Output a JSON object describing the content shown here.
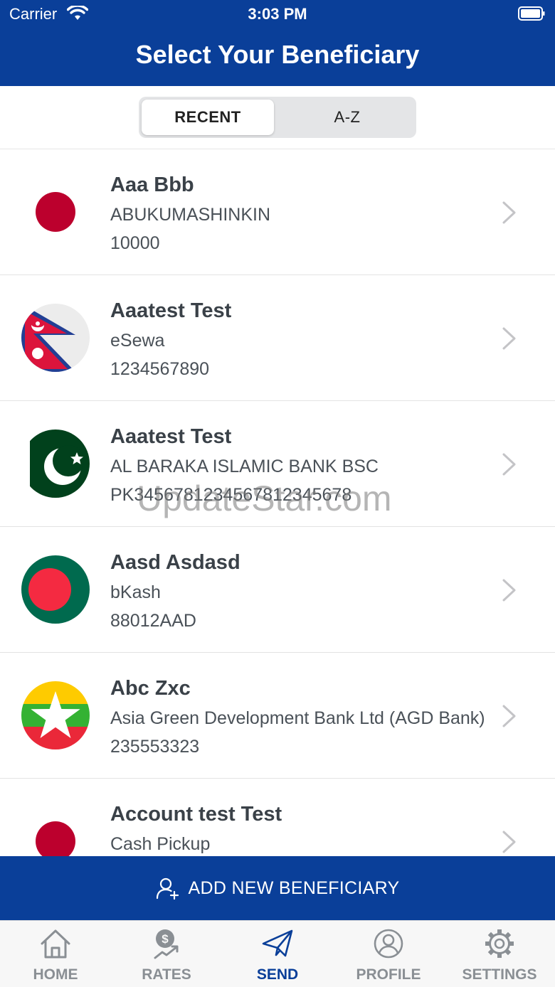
{
  "status_bar": {
    "carrier": "Carrier",
    "time": "3:03 PM"
  },
  "header": {
    "title": "Select Your Beneficiary"
  },
  "segment": {
    "recent": "RECENT",
    "az": "A-Z"
  },
  "beneficiaries": [
    {
      "name": "Aaa Bbb",
      "bank": "ABUKUMASHINKIN",
      "account": "10000",
      "flag": "japan-flag-icon"
    },
    {
      "name": "Aaatest Test",
      "bank": "eSewa",
      "account": "1234567890",
      "flag": "nepal-flag-icon"
    },
    {
      "name": "Aaatest Test",
      "bank": "AL BARAKA ISLAMIC BANK BSC",
      "account": "PK3456781234567812345678",
      "flag": "pakistan-flag-icon"
    },
    {
      "name": "Aasd Asdasd",
      "bank": "bKash",
      "account": "88012AAD",
      "flag": "bangladesh-flag-icon"
    },
    {
      "name": "Abc Zxc",
      "bank": "Asia Green Development Bank Ltd (AGD Bank)",
      "account": "235553323",
      "flag": "myanmar-flag-icon"
    },
    {
      "name": "Account test Test",
      "bank": "Cash Pickup",
      "account": "",
      "flag": "japan-flag-icon"
    }
  ],
  "watermark": "UpdateStar.com",
  "add_button": {
    "label": "ADD NEW BENEFICIARY"
  },
  "tabs": [
    {
      "label": "HOME",
      "icon": "home-icon"
    },
    {
      "label": "RATES",
      "icon": "rates-icon"
    },
    {
      "label": "SEND",
      "icon": "send-icon",
      "active": true
    },
    {
      "label": "PROFILE",
      "icon": "profile-icon"
    },
    {
      "label": "SETTINGS",
      "icon": "settings-icon"
    }
  ],
  "colors": {
    "primary": "#0a3f99",
    "tab_inactive": "#8a8f94",
    "japan_red": "#bc002d",
    "bangladesh_green": "#006a4e",
    "bangladesh_red": "#f42a41"
  }
}
